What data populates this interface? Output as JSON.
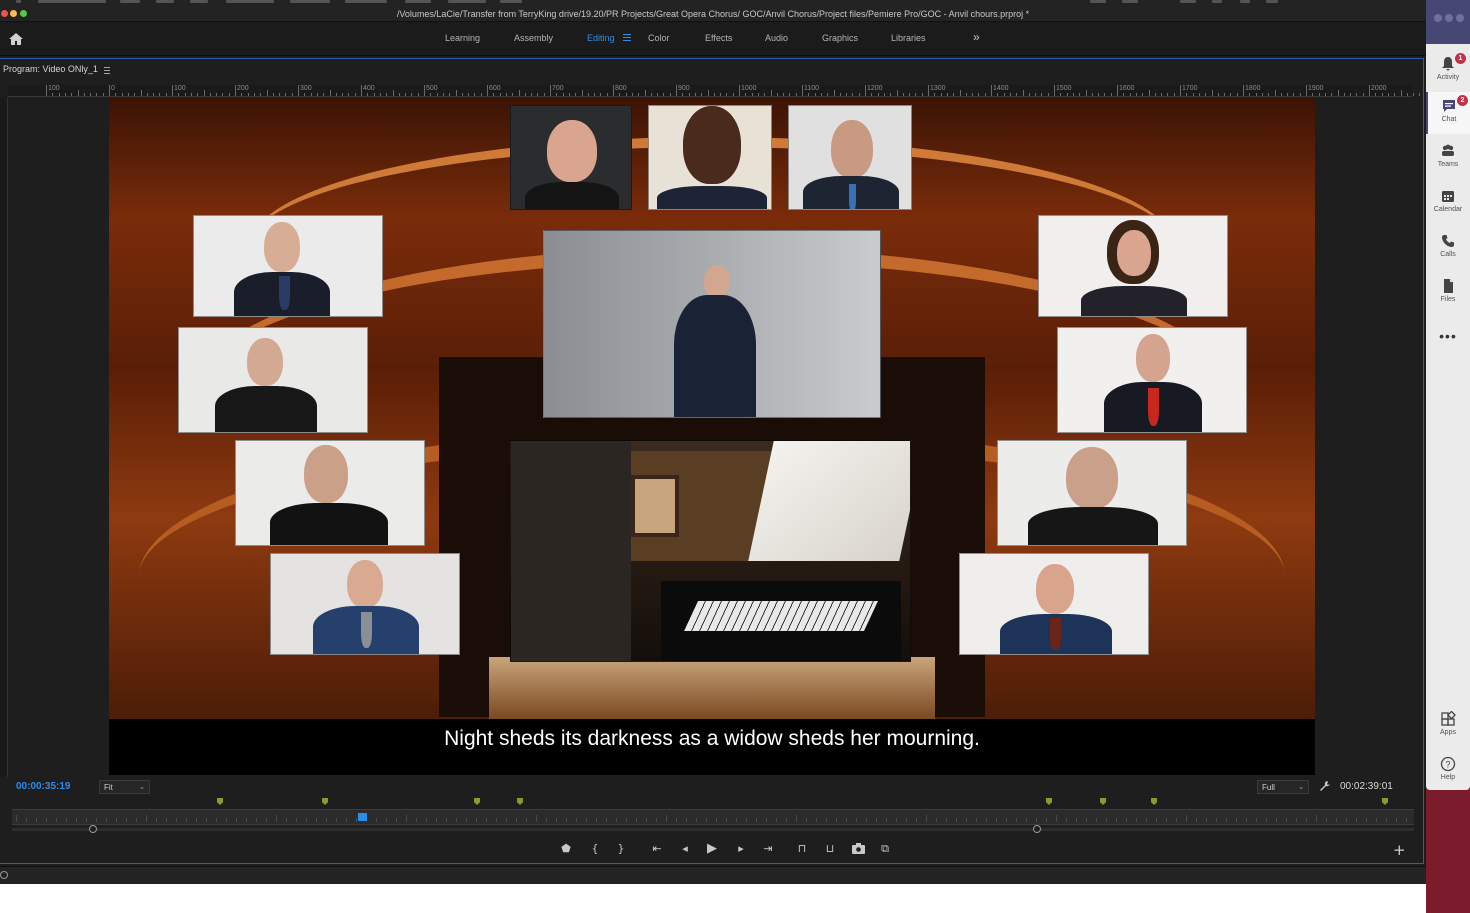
{
  "titlebar": {
    "path": "/Volumes/LaCie/Transfer from TerryKing drive/19.20/PR Projects/Great Opera Chorus/ GOC/Anvil Chorus/Project files/Pemiere Pro/GOC - Anvil chours.prproj *"
  },
  "workspace": {
    "tabs": [
      {
        "label": "Learning"
      },
      {
        "label": "Assembly"
      },
      {
        "label": "Editing"
      },
      {
        "label": "Color"
      },
      {
        "label": "Effects"
      },
      {
        "label": "Audio"
      },
      {
        "label": "Graphics"
      },
      {
        "label": "Libraries"
      }
    ],
    "active_tab": "Editing",
    "accent": "#2d8ceb"
  },
  "monitor": {
    "title": "Program: Video ONly_1",
    "ruler_labels": [
      "100",
      "0",
      "100",
      "200",
      "300",
      "400",
      "500",
      "600",
      "700",
      "800",
      "900",
      "1000",
      "1100",
      "1200",
      "1300",
      "1400",
      "1500",
      "1600",
      "1700",
      "1800",
      "1900",
      "2000"
    ],
    "caption": "Night sheds its darkness as a widow sheds her mourning.",
    "timecode_current": "00:00:35:19",
    "timecode_duration": "00:02:39:01",
    "zoom_select": "Fit",
    "resolution_select": "Full"
  },
  "teams": {
    "rail": [
      {
        "label": "Activity",
        "icon": "bell-icon",
        "badge": "1"
      },
      {
        "label": "Chat",
        "icon": "chat-icon",
        "badge": "2"
      },
      {
        "label": "Teams",
        "icon": "teams-icon"
      },
      {
        "label": "Calendar",
        "icon": "calendar-icon"
      },
      {
        "label": "Calls",
        "icon": "phone-icon"
      },
      {
        "label": "Files",
        "icon": "file-icon"
      }
    ],
    "active": "Chat",
    "bottom": [
      {
        "label": "Apps",
        "icon": "apps-icon"
      },
      {
        "label": "Help",
        "icon": "help-icon"
      }
    ],
    "brand_color": "#464775"
  }
}
